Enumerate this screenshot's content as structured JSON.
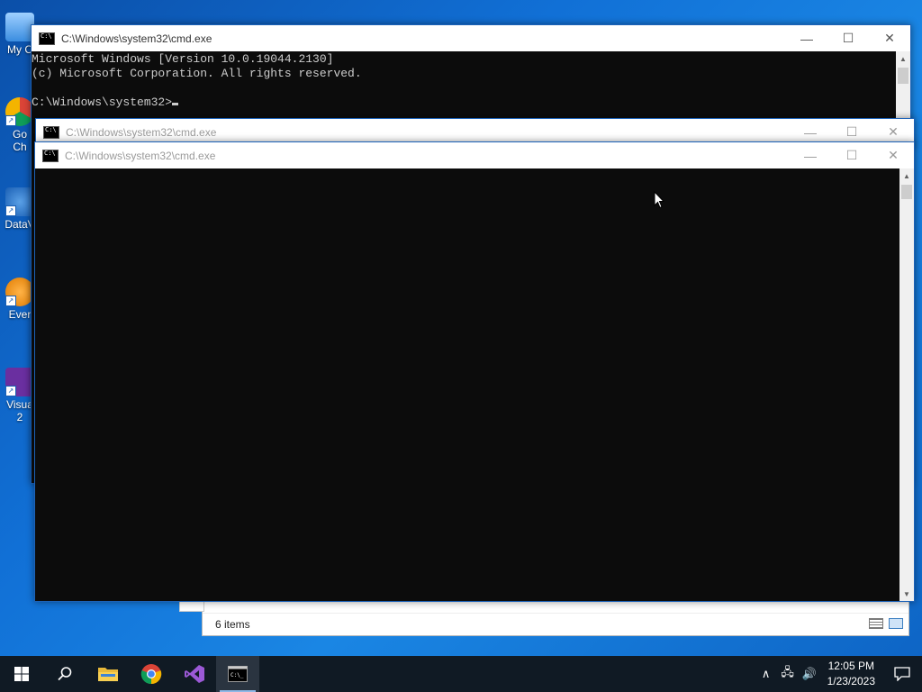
{
  "desktop": {
    "icons": [
      {
        "label": "My C",
        "label2": ""
      },
      {
        "label": "Go",
        "label2": "Ch"
      },
      {
        "label": "DataV",
        "label2": ""
      },
      {
        "label": "Ever",
        "label2": ""
      },
      {
        "label": "Visua",
        "label2": "2"
      }
    ]
  },
  "explorer": {
    "status_count": "6 items"
  },
  "cmd_windows": [
    {
      "title": "C:\\Windows\\system32\\cmd.exe",
      "lines": [
        "Microsoft Windows [Version 10.0.19044.2130]",
        "(c) Microsoft Corporation. All rights reserved.",
        "",
        "C:\\Windows\\system32>"
      ]
    },
    {
      "title": "C:\\Windows\\system32\\cmd.exe"
    },
    {
      "title": "C:\\Windows\\system32\\cmd.exe"
    }
  ],
  "window_controls": {
    "minimize": "—",
    "maximize": "☐",
    "close": "✕"
  },
  "taskbar": {
    "apps": [
      "windows-start",
      "search",
      "file-explorer",
      "chrome",
      "visual-studio",
      "command-prompt"
    ],
    "tray": {
      "chevron": "∧",
      "network": "🖧",
      "volume": "🔊"
    },
    "time": "12:05 PM",
    "date": "1/23/2023"
  }
}
